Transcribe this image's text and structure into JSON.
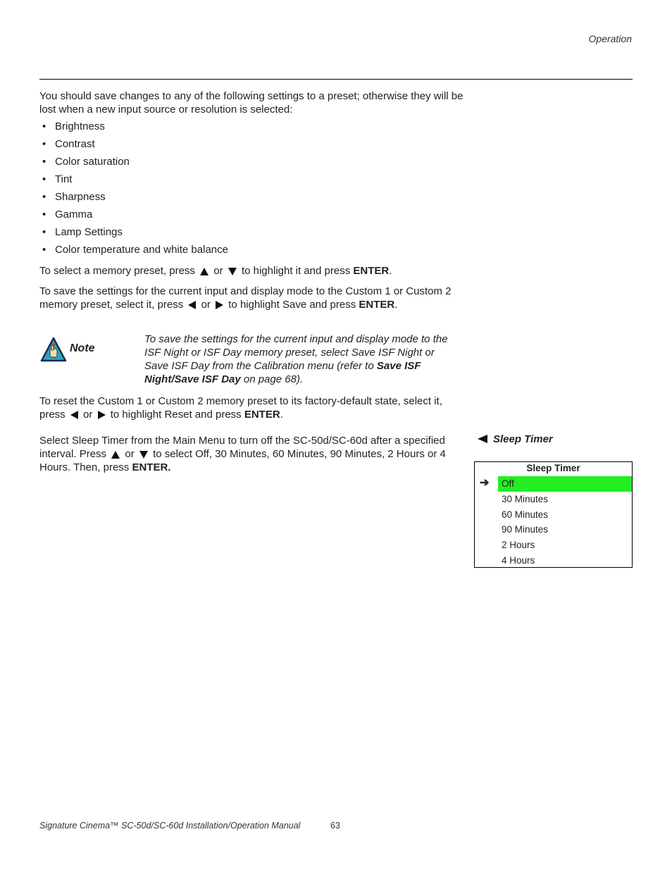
{
  "header": {
    "section": "Operation"
  },
  "intro": "You should save changes to any of the following settings to a preset; otherwise they will be lost when a new input source or resolution is selected:",
  "settings_list": [
    "Brightness",
    "Contrast",
    "Color saturation",
    "Tint",
    "Sharpness",
    "Gamma",
    "Lamp Settings",
    "Color temperature and white balance"
  ],
  "select_para": {
    "pre": "To select a memory preset, press",
    "or": "or",
    "post": "to highlight it and press",
    "key": "ENTER",
    "end": "."
  },
  "save_para": {
    "pre": "To save the settings for the current input and display mode to the Custom 1 or Custom 2 memory preset, select it, press",
    "or": "or",
    "post": "to highlight Save and press",
    "key": "ENTER",
    "end": "."
  },
  "note": {
    "label": "Note",
    "text_pre": "To save the settings for the current input and display mode to the ISF Night or ISF Day memory preset, select Save ISF Night or Save ISF Day from the Calibration menu (refer to",
    "ref": "Save ISF Night/Save ISF Day",
    "text_post": "on page 68)."
  },
  "reset_para": {
    "pre": "To reset the Custom 1 or Custom 2 memory preset to its factory-default state, select it, press",
    "or": "or",
    "post": "to highlight Reset and press",
    "key": "ENTER",
    "end": "."
  },
  "sleep_para": {
    "pre": "Select Sleep Timer from the Main Menu to turn off the SC-50d/SC-60d after a specified interval. Press",
    "or": "or",
    "post": "to select Off, 30 Minutes, 60 Minutes, 90 Minutes, 2 Hours or 4 Hours. Then, press",
    "key": "ENTER."
  },
  "side_heading": "Sleep Timer",
  "menu": {
    "title": "Sleep Timer",
    "selected_index": 0,
    "highlight_color": "#22ee22",
    "items": [
      "Off",
      "30 Minutes",
      "60 Minutes",
      "90 Minutes",
      "2 Hours",
      "4 Hours"
    ]
  },
  "footer": {
    "title": "Signature Cinema™ SC-50d/SC-60d Installation/Operation Manual",
    "page": "63"
  }
}
